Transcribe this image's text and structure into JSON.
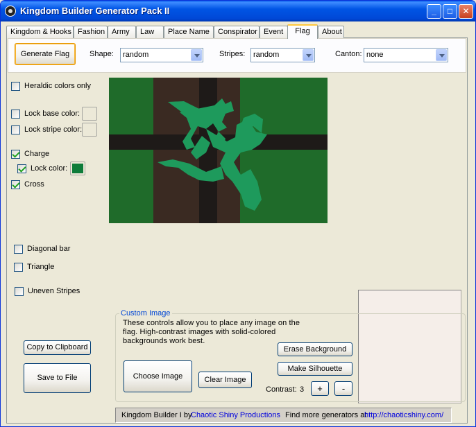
{
  "window": {
    "title": "Kingdom Builder Generator Pack II"
  },
  "tabs": [
    {
      "label": "Kingdom & Hooks"
    },
    {
      "label": "Fashion"
    },
    {
      "label": "Army"
    },
    {
      "label": "Law"
    },
    {
      "label": "Place Name"
    },
    {
      "label": "Conspirator"
    },
    {
      "label": "Event"
    },
    {
      "label": "Flag"
    },
    {
      "label": "About"
    }
  ],
  "active_tab": "Flag",
  "toolbar": {
    "generate_label": "Generate Flag",
    "shape_label": "Shape:",
    "shape_value": "random",
    "stripes_label": "Stripes:",
    "stripes_value": "random",
    "canton_label": "Canton:",
    "canton_value": "none"
  },
  "options": {
    "heraldic": {
      "label": "Heraldic colors only",
      "checked": false
    },
    "lock_base": {
      "label": "Lock base color:",
      "checked": false
    },
    "lock_stripe": {
      "label": "Lock stripe color:",
      "checked": false
    },
    "charge": {
      "label": "Charge",
      "checked": true
    },
    "lock_color": {
      "label": "Lock color:",
      "checked": true,
      "color": "#0E7C3A"
    },
    "cross": {
      "label": "Cross",
      "checked": true
    },
    "diagonal": {
      "label": "Diagonal bar",
      "checked": false
    },
    "triangle": {
      "label": "Triangle",
      "checked": false
    },
    "uneven": {
      "label": "Uneven Stripes",
      "checked": false
    }
  },
  "flag": {
    "field_outer": "#1F6B2A",
    "field_center": "#3A2A22",
    "cross_color": "#1E1A18",
    "charge_color": "#1E9A5C",
    "charge_icon": "dragon-icon"
  },
  "buttons": {
    "copy": "Copy to Clipboard",
    "save": "Save to File",
    "choose": "Choose Image",
    "clear": "Clear Image",
    "erase": "Erase Background",
    "silhouette": "Make Silhouette",
    "plus": "+",
    "minus": "-"
  },
  "custom_image": {
    "title": "Custom Image",
    "help": "These controls allow you to place any image on the flag. High-contrast  images with solid-colored backgrounds work best.",
    "contrast_label": "Contrast:",
    "contrast_value": "3"
  },
  "status": {
    "prefix": "Kingdom Builder I by ",
    "credit_link": "Chaotic Shiny Productions",
    "more": "Find more generators at ",
    "url": "http://chaoticshiny.com/"
  }
}
